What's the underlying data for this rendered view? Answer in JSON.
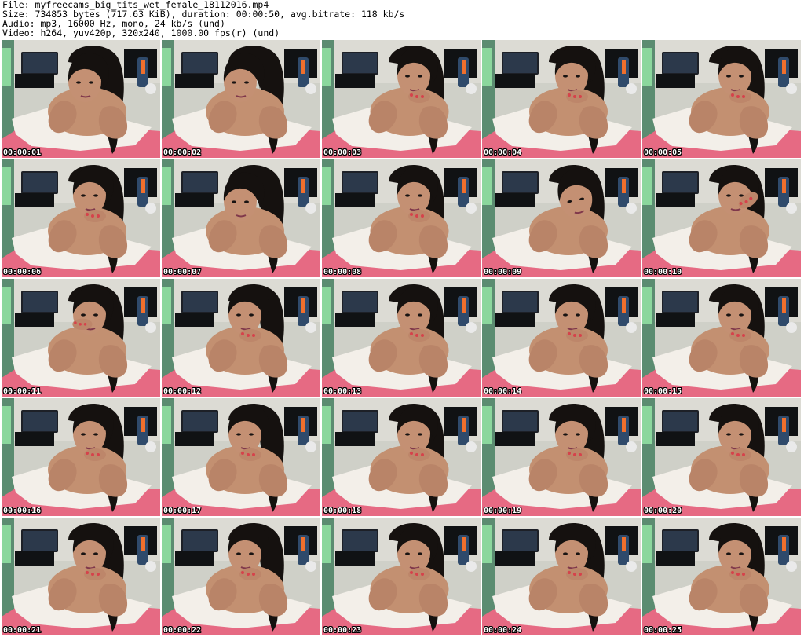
{
  "header": {
    "file": "File: myfreecams_big_tits_wet_female_18112016.mp4",
    "size": "Size: 734853 bytes (717.63 KiB), duration: 00:00:50, avg.bitrate: 118 kb/s",
    "audio": "Audio: mp3, 16000 Hz, mono, 24 kb/s (und)",
    "video": "Video: h264, yuv420p, 320x240, 1000.00 fps(r) (und)"
  },
  "colors": {
    "background": "#ffffff",
    "header_text": "#000000",
    "timestamp_text": "#ffffff",
    "timestamp_outline": "#000000",
    "wall": "#d8d8d2",
    "bed_pink": "#e66a83",
    "pillow_white": "#f3efe9",
    "hair_black": "#15110f",
    "skin": "#c49073",
    "nail_red": "#d6424b"
  },
  "thumbnails": [
    {
      "timestamp": "00:00:01",
      "pose": "lean-forward"
    },
    {
      "timestamp": "00:00:02",
      "pose": "lean-forward"
    },
    {
      "timestamp": "00:00:03",
      "pose": "hand-chin"
    },
    {
      "timestamp": "00:00:04",
      "pose": "hand-chin"
    },
    {
      "timestamp": "00:00:05",
      "pose": "hand-chin"
    },
    {
      "timestamp": "00:00:06",
      "pose": "hand-chin"
    },
    {
      "timestamp": "00:00:07",
      "pose": "lean-forward"
    },
    {
      "timestamp": "00:00:08",
      "pose": "hand-chin"
    },
    {
      "timestamp": "00:00:09",
      "pose": "look-down"
    },
    {
      "timestamp": "00:00:10",
      "pose": "hand-ear"
    },
    {
      "timestamp": "00:00:11",
      "pose": "hand-mouth"
    },
    {
      "timestamp": "00:00:12",
      "pose": "hand-chin"
    },
    {
      "timestamp": "00:00:13",
      "pose": "hand-chin"
    },
    {
      "timestamp": "00:00:14",
      "pose": "hand-chin"
    },
    {
      "timestamp": "00:00:15",
      "pose": "hand-chin"
    },
    {
      "timestamp": "00:00:16",
      "pose": "hand-chin"
    },
    {
      "timestamp": "00:00:17",
      "pose": "hand-chin"
    },
    {
      "timestamp": "00:00:18",
      "pose": "hand-chin"
    },
    {
      "timestamp": "00:00:19",
      "pose": "hand-chin"
    },
    {
      "timestamp": "00:00:20",
      "pose": "hand-chin"
    },
    {
      "timestamp": "00:00:21",
      "pose": "hand-chin"
    },
    {
      "timestamp": "00:00:22",
      "pose": "hand-chin"
    },
    {
      "timestamp": "00:00:23",
      "pose": "hand-chin"
    },
    {
      "timestamp": "00:00:24",
      "pose": "hand-chin"
    },
    {
      "timestamp": "00:00:25",
      "pose": "hand-chin"
    }
  ]
}
